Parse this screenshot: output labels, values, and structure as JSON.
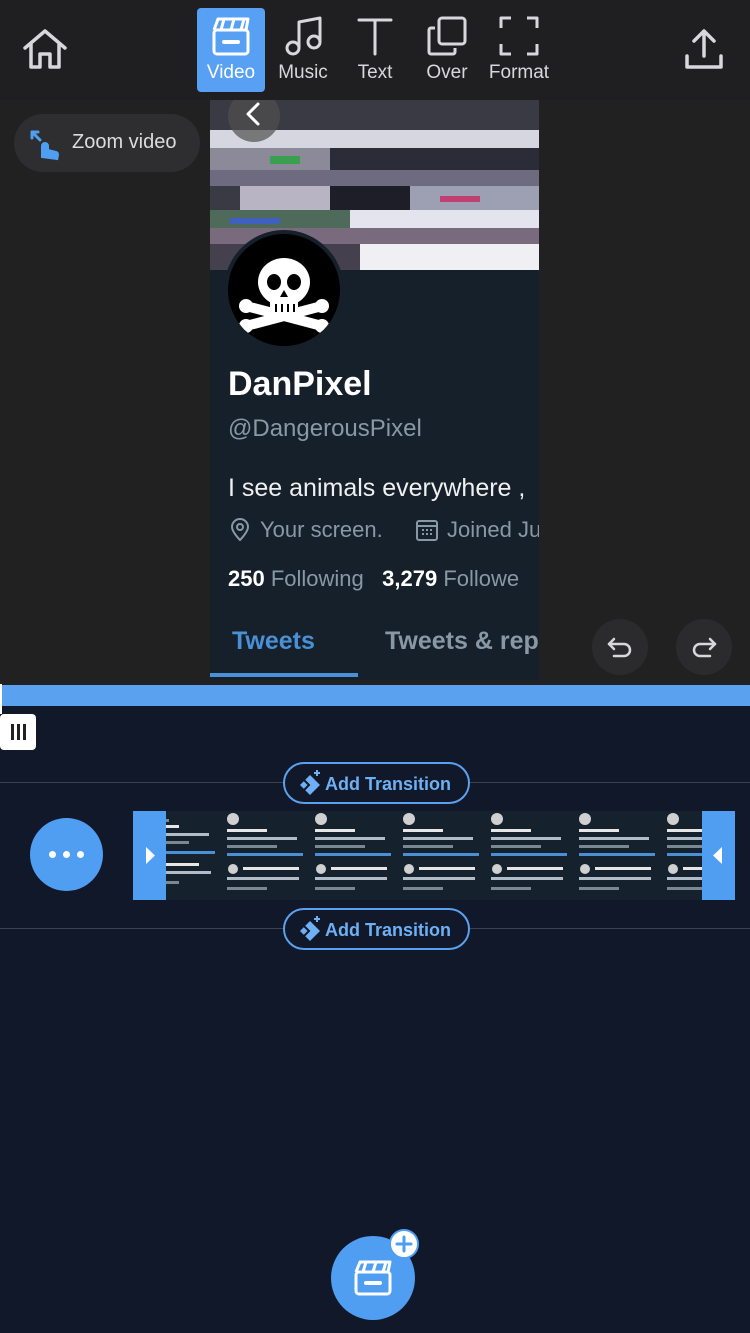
{
  "toolbar": {
    "tabs": [
      {
        "label": "Video",
        "icon": "clapperboard-icon",
        "active": true
      },
      {
        "label": "Music",
        "icon": "music-note-icon",
        "active": false
      },
      {
        "label": "Text",
        "icon": "text-icon",
        "active": false
      },
      {
        "label": "Over",
        "icon": "overlay-icon",
        "active": false
      },
      {
        "label": "Format",
        "icon": "format-frame-icon",
        "active": false
      }
    ],
    "home_icon": "home-icon",
    "share_icon": "share-upload-icon"
  },
  "preview": {
    "zoom_label": "Zoom video",
    "video": {
      "name": "DanPixel",
      "handle": "@DangerousPixel",
      "bio": "I see animals everywhere ,",
      "location": "Your screen.",
      "joined": "Joined Ju",
      "following_count": "250",
      "following_label": "Following",
      "followers_count": "3,279",
      "followers_label": "Followe",
      "tab_tweets": "Tweets",
      "tab_replies": "Tweets & rep"
    }
  },
  "timeline": {
    "add_transition_top": "Add Transition",
    "add_transition_bottom": "Add Transition"
  },
  "colors": {
    "accent": "#4f9ef2",
    "background": "#111829",
    "toolbar": "#1f1f21",
    "preview_bg": "#212121"
  }
}
